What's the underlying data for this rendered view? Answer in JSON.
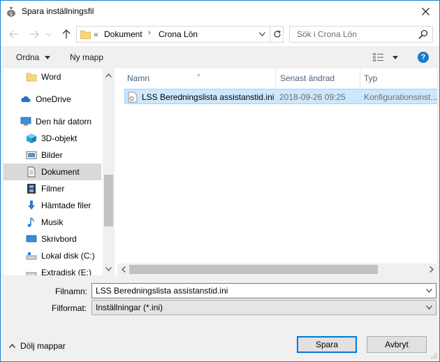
{
  "window": {
    "title": "Spara inställningsfil"
  },
  "nav": {
    "address": {
      "overflow": "«",
      "crumbs": [
        "Dokument",
        "Crona Lön"
      ]
    },
    "search_placeholder": "Sök i Crona Lön"
  },
  "toolbar": {
    "organize": "Ordna",
    "new_folder": "Ny mapp"
  },
  "sidebar": {
    "items": [
      {
        "label": "Word",
        "icon": "folder-icon"
      },
      {
        "label": "OneDrive",
        "icon": "cloud-icon"
      },
      {
        "label": "Den här datorn",
        "icon": "computer-icon"
      },
      {
        "label": "3D-objekt",
        "icon": "cube-icon"
      },
      {
        "label": "Bilder",
        "icon": "pictures-icon"
      },
      {
        "label": "Dokument",
        "icon": "document-icon",
        "selected": true
      },
      {
        "label": "Filmer",
        "icon": "film-icon"
      },
      {
        "label": "Hämtade filer",
        "icon": "download-icon"
      },
      {
        "label": "Musik",
        "icon": "music-icon"
      },
      {
        "label": "Skrivbord",
        "icon": "desktop-icon"
      },
      {
        "label": "Lokal disk (C:)",
        "icon": "drive-icon"
      },
      {
        "label": "Extradisk (E:)",
        "icon": "drive-icon"
      }
    ]
  },
  "files": {
    "columns": [
      "Namn",
      "Senast ändrad",
      "Typ"
    ],
    "rows": [
      {
        "name": "LSS Beredningslista assistanstid.ini",
        "modified": "2018-09-26 09:25",
        "type": "Konfigurationsinst..."
      }
    ]
  },
  "form": {
    "filename_label": "Filnamn:",
    "filename_value": "LSS Beredningslista assistanstid.ini",
    "format_label": "Filformat:",
    "format_value": "Inställningar (*.ini)"
  },
  "footer": {
    "hide_folders": "Dölj mappar",
    "save": "Spara",
    "cancel": "Avbryt"
  },
  "colors": {
    "accent": "#0078d7",
    "selection": "#cce8ff",
    "selection_border": "#99d1ff",
    "folder": "#f8d775"
  }
}
